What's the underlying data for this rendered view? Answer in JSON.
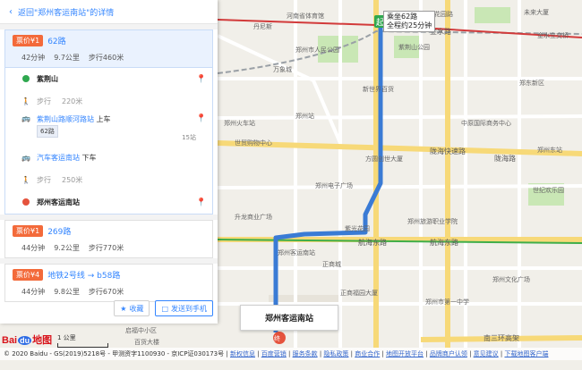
{
  "back_link": "返回\"郑州客运南站\"的详情",
  "plans": [
    {
      "fare": "票价¥1",
      "route": "62路",
      "duration": "42分钟",
      "distance": "9.7公里",
      "walk": "步行460米",
      "steps": [
        {
          "type": "start",
          "text": "紫荆山"
        },
        {
          "type": "walk",
          "label": "步行",
          "distance": "220米"
        },
        {
          "type": "bus_on",
          "stop": "紫荆山路顺河路站",
          "action": "上车",
          "line": "62路",
          "stops": "15站"
        },
        {
          "type": "bus_off",
          "stop": "汽车客运南站",
          "action": "下车"
        },
        {
          "type": "walk",
          "label": "步行",
          "distance": "250米"
        },
        {
          "type": "end",
          "text": "郑州客运南站"
        }
      ]
    },
    {
      "fare": "票价¥1",
      "route": "269路",
      "duration": "44分钟",
      "distance": "9.2公里",
      "walk": "步行770米"
    },
    {
      "fare": "票价¥4",
      "route": "地铁2号线 → b58路",
      "duration": "44分钟",
      "distance": "9.8公里",
      "walk": "步行670米"
    }
  ],
  "buttons": {
    "favorite": "收藏",
    "send": "发送到手机"
  },
  "map": {
    "route_bubble_line1": "乘坐62路",
    "route_bubble_line2": "全程约25分钟",
    "start_marker": "起",
    "end_marker": "终",
    "destination_callout": "郑州客运南站",
    "roads": [
      "金水路",
      "陇海快速路",
      "陇海路",
      "航海东路",
      "航海东路",
      "南三环高架"
    ],
    "labels": [
      "河南省体育馆",
      "郑州市人民公园",
      "紫荆山公园",
      "丹尼斯",
      "万象城",
      "新世界百货",
      "郑州站",
      "世贸购物中心",
      "方圆创世大厦",
      "郑州电子广场",
      "郑州火车站",
      "郑州东站",
      "郑州客运南站",
      "升龙商业广场",
      "紫光花园",
      "正商城",
      "正商福园大厦",
      "郑州旅游职业学院",
      "郑州市第一中学",
      "郑州文化广场",
      "世纪欢乐园",
      "未来大厦",
      "花园路",
      "金水立交桥",
      "中原国际商务中心",
      "郑东新区",
      "启福中小区",
      "百货大楼",
      "郑州客运南站"
    ]
  },
  "logo": {
    "bai": "Bai",
    "du": "du",
    "map": "地图"
  },
  "scale": "1 公里",
  "footer": {
    "copyright": "© 2020 Baidu - GS(2019)5218号 - 甲测资字1100930 - 京ICP证030173号 |",
    "links": [
      "新权信息",
      "百度营销",
      "服务条款",
      "隐私政策",
      "商业合作",
      "地图开放平台",
      "品牌商户认领",
      "意见建议",
      "下载地图客户端"
    ]
  },
  "colors": {
    "accent": "#3385ff",
    "fare_tag": "#f36a3a",
    "route_line": "#3a7bd5",
    "metro_red": "#d23a3a",
    "metro_green": "#3fae49"
  }
}
